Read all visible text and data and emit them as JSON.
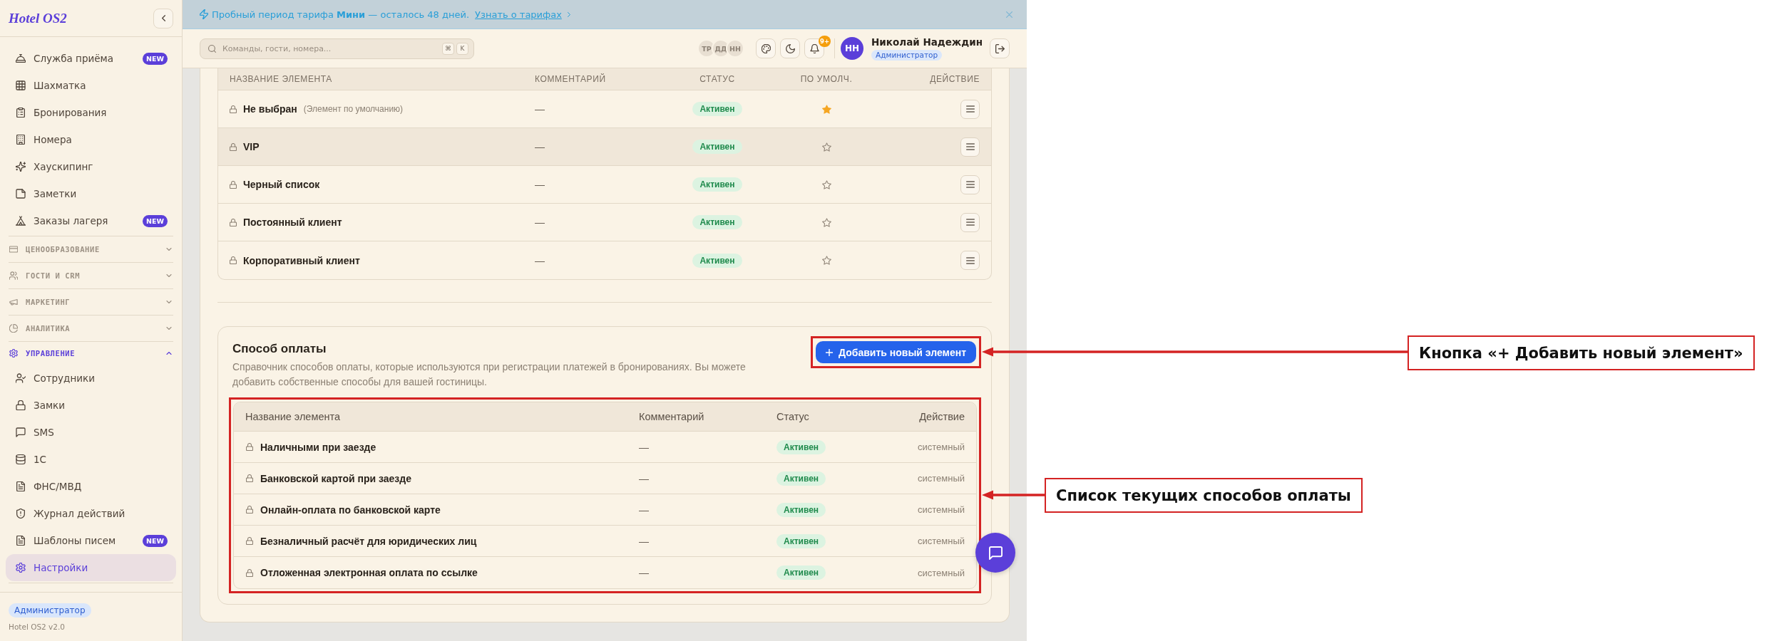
{
  "sidebar": {
    "logo": "Hotel OS2",
    "items": [
      {
        "label": "Служба приёма",
        "badge": "NEW",
        "selected": false
      },
      {
        "label": "Шахматка",
        "selected": false
      },
      {
        "label": "Бронирования",
        "selected": false
      },
      {
        "label": "Номера",
        "selected": false
      },
      {
        "label": "Хаускипинг",
        "selected": false
      },
      {
        "label": "Заметки",
        "selected": false
      },
      {
        "label": "Заказы лагеря",
        "badge": "NEW",
        "selected": false
      }
    ],
    "groups": [
      {
        "label": "ЦЕНООБРАЗОВАНИЕ",
        "expanded": false
      },
      {
        "label": "ГОСТИ И CRM",
        "expanded": false
      },
      {
        "label": "МАРКЕТИНГ",
        "expanded": false
      },
      {
        "label": "АНАЛИТИКА",
        "expanded": false
      },
      {
        "label": "УПРАВЛЕНИЕ",
        "expanded": true,
        "children": [
          {
            "label": "Сотрудники",
            "selected": false
          },
          {
            "label": "Замки",
            "selected": false
          },
          {
            "label": "SMS",
            "selected": false
          },
          {
            "label": "1С",
            "selected": false
          },
          {
            "label": "ФНС/МВД",
            "selected": false
          },
          {
            "label": "Журнал действий",
            "selected": false
          },
          {
            "label": "Шаблоны писем",
            "badge": "NEW",
            "selected": false
          },
          {
            "label": "Настройки",
            "selected": true
          }
        ]
      }
    ],
    "footer": {
      "role": "Администратор",
      "version": "Hotel OS2 v2.0"
    }
  },
  "banner": {
    "text": "Пробный период тарифа **Мини** — осталось 48 дней.",
    "link": "Узнать о тарифах"
  },
  "topbar": {
    "search": {
      "placeholder": "Команды, гости, номера...",
      "keys": [
        "⌘",
        "K"
      ]
    },
    "online_users": [
      "ТР",
      "ДД",
      "НН"
    ],
    "notifications_badge": "9+",
    "user": {
      "initials": "НН",
      "name": "Николай Надеждин",
      "role": "Администратор"
    }
  },
  "upper_list": {
    "columns": [
      "НАЗВАНИЕ ЭЛЕМЕНТА",
      "КОММЕНТАРИЙ",
      "СТАТУС",
      "ПО УМОЛЧ.",
      "ДЕЙСТВИЕ"
    ],
    "rows": [
      {
        "name": "Не выбран",
        "note": "(Элемент по умолчанию)",
        "comment": "—",
        "status": "Активен",
        "default": true,
        "hovered": false
      },
      {
        "name": "VIP",
        "comment": "—",
        "status": "Активен",
        "default": false,
        "hovered": true
      },
      {
        "name": "Черный список",
        "comment": "—",
        "status": "Активен",
        "default": false,
        "hovered": false
      },
      {
        "name": "Постоянный клиент",
        "comment": "—",
        "status": "Активен",
        "default": false,
        "hovered": false
      },
      {
        "name": "Корпоративный клиент",
        "comment": "—",
        "status": "Активен",
        "default": false,
        "hovered": false
      }
    ]
  },
  "payment_methods": {
    "title": "Способ оплаты",
    "description": "Справочник способов оплаты, которые используются при регистрации платежей в бронированиях. Вы можете добавить собственные способы для вашей гостиницы.",
    "add_button": "Добавить новый элемент",
    "columns": [
      "Название элемента",
      "Комментарий",
      "Статус",
      "Действие"
    ],
    "rows": [
      {
        "name": "Наличными при заезде",
        "comment": "—",
        "status": "Активен",
        "action": "системный"
      },
      {
        "name": "Банковской картой при заезде",
        "comment": "—",
        "status": "Активен",
        "action": "системный"
      },
      {
        "name": "Онлайн-оплата по банковской карте",
        "comment": "—",
        "status": "Активен",
        "action": "системный"
      },
      {
        "name": "Безналичный расчёт для юридических лиц",
        "comment": "—",
        "status": "Активен",
        "action": "системный"
      },
      {
        "name": "Отложенная электронная оплата по ссылке",
        "comment": "—",
        "status": "Активен",
        "action": "системный"
      }
    ]
  },
  "annotations": [
    {
      "label": "Кнопка «+ Добавить новый элемент»"
    },
    {
      "label": "Список текущих способов оплаты"
    }
  ]
}
